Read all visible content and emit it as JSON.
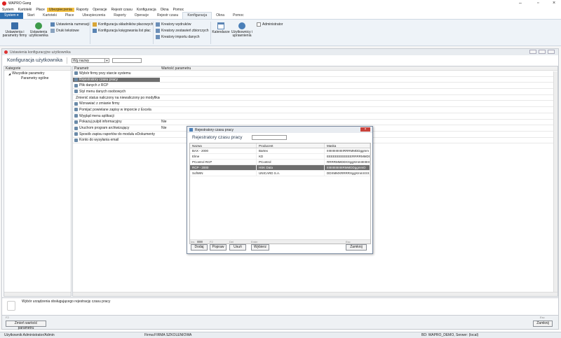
{
  "app": {
    "title": "WAPRO Gang"
  },
  "menu": [
    "System",
    "Kartoteki",
    "Płace",
    "Ubezpieczenia",
    "Raporty",
    "Operacje",
    "Rejestr czasu",
    "Konfiguracja",
    "Okna",
    "Pomoc"
  ],
  "ribbon_tabs": [
    "System ▾",
    "Start",
    "Kartoteki",
    "Płace",
    "Ubezpieczenia",
    "Raporty",
    "Operacje",
    "Rejestr czasu",
    "Konfiguracja",
    "Okna",
    "Pomoc"
  ],
  "ribbon": {
    "firm_params": "Ustawienia i parametry firmy",
    "user_settings": "Ustawienia użytkownika",
    "numbering": "Ustawienia numeracji",
    "text_prints": "Druki tekstowe",
    "payroll_config": "Konfiguracja składników płacowych",
    "ledger_config": "Konfiguracja księgowania list płac",
    "wizard_prints": "Kreatory wydruków",
    "wizard_sets": "Kreatory zestawień zbiorczych",
    "wizard_import": "Kreatory importu danych",
    "calendars": "Kalendarze",
    "users": "Użytkownicy i uprawnienia",
    "admin": "Administrator"
  },
  "inner": {
    "window_title": "Ustawienia konfiguracyjne użytkownika",
    "heading": "Konfiguracja użytkownika",
    "filter_value": "Wg nazwy",
    "category_header": "Kategorie",
    "categories": [
      "Wszystkie parametry",
      "Parametry ogólne"
    ],
    "param_header": "Parametr",
    "value_header": "Wartość parametru",
    "params": [
      {
        "name": "Wybór firmy przy starcie systemu",
        "value": ""
      },
      {
        "name": "Rejestratory czasu pracy",
        "value": ""
      },
      {
        "name": "Plik danych z RCP",
        "value": ""
      },
      {
        "name": "Styl menu danych osobowych",
        "value": ""
      },
      {
        "name": "Zmienić status naliczony na niewaliczony po modyfikacji",
        "value": ""
      },
      {
        "name": "Wznawiać z zmianie firmy",
        "value": ""
      },
      {
        "name": "Pomijać powielane zapisy w imporcie z Excela",
        "value": ""
      },
      {
        "name": "Wygląd menu aplikacji",
        "value": ""
      },
      {
        "name": "Pokazuj pulpit informacyjny",
        "value": "Nie"
      },
      {
        "name": "Uruchom program archiwizujący",
        "value": "Nie"
      },
      {
        "name": "Sposób zapisu raportów do modułu eDokumenty",
        "value": ""
      },
      {
        "name": "Konto do wysyłania email",
        "value": ""
      }
    ],
    "description": "Wybór urządzenia obsługującego rejestrację czasu pracy",
    "change_button": "Zmień wartość parametru",
    "close_button": "Zamknij",
    "f2_key": "F2",
    "esc_key": "Esc"
  },
  "dialog": {
    "title": "Rejestratory czasu pracy",
    "heading": "Rejestratory czasu pracy",
    "columns": [
      "Nazwa",
      "Producent",
      "Maska"
    ],
    "rows": [
      [
        "BAX - 2000",
        "Bartex",
        "IIIIIIIIIIIIIIIIIIIRRRMMDDggmm"
      ],
      [
        "Elme",
        "KD",
        "EEEEEEEEEEEERRRRMMDDggmm"
      ],
      [
        "PControl RCP",
        "PControl",
        "RRRRMMDDXXggXmmIIIIIIIIII"
      ],
      [
        "RCP - 2000",
        "HSK Data",
        "IIIIIIIIIIIIIIIIIIRMMDDggmmD"
      ],
      [
        "SofWIN",
        "UNICARD S.A.",
        "DDXMMXRRRRXggXmmXXXXXXXX"
      ]
    ],
    "buttons": [
      {
        "key": "Ins",
        "label": "Dodaj"
      },
      {
        "key": "F2",
        "label": "Popraw"
      },
      {
        "key": "Del",
        "label": "Usuń"
      },
      {
        "key": "Enter",
        "label": "Wybierz"
      },
      {
        "key": "Esc",
        "label": "Zamknij"
      }
    ]
  },
  "status": {
    "user": "Użytkownik:Administrator/Admin",
    "firm": "Firma:FIRMA SZKOLENIOWA",
    "db": "BD: WAPRO_DEMO, Serwer: (local)"
  },
  "colors": {
    "highlight": "#f5c242",
    "selection": "#6f6f6f",
    "accent": "#c9413a"
  }
}
